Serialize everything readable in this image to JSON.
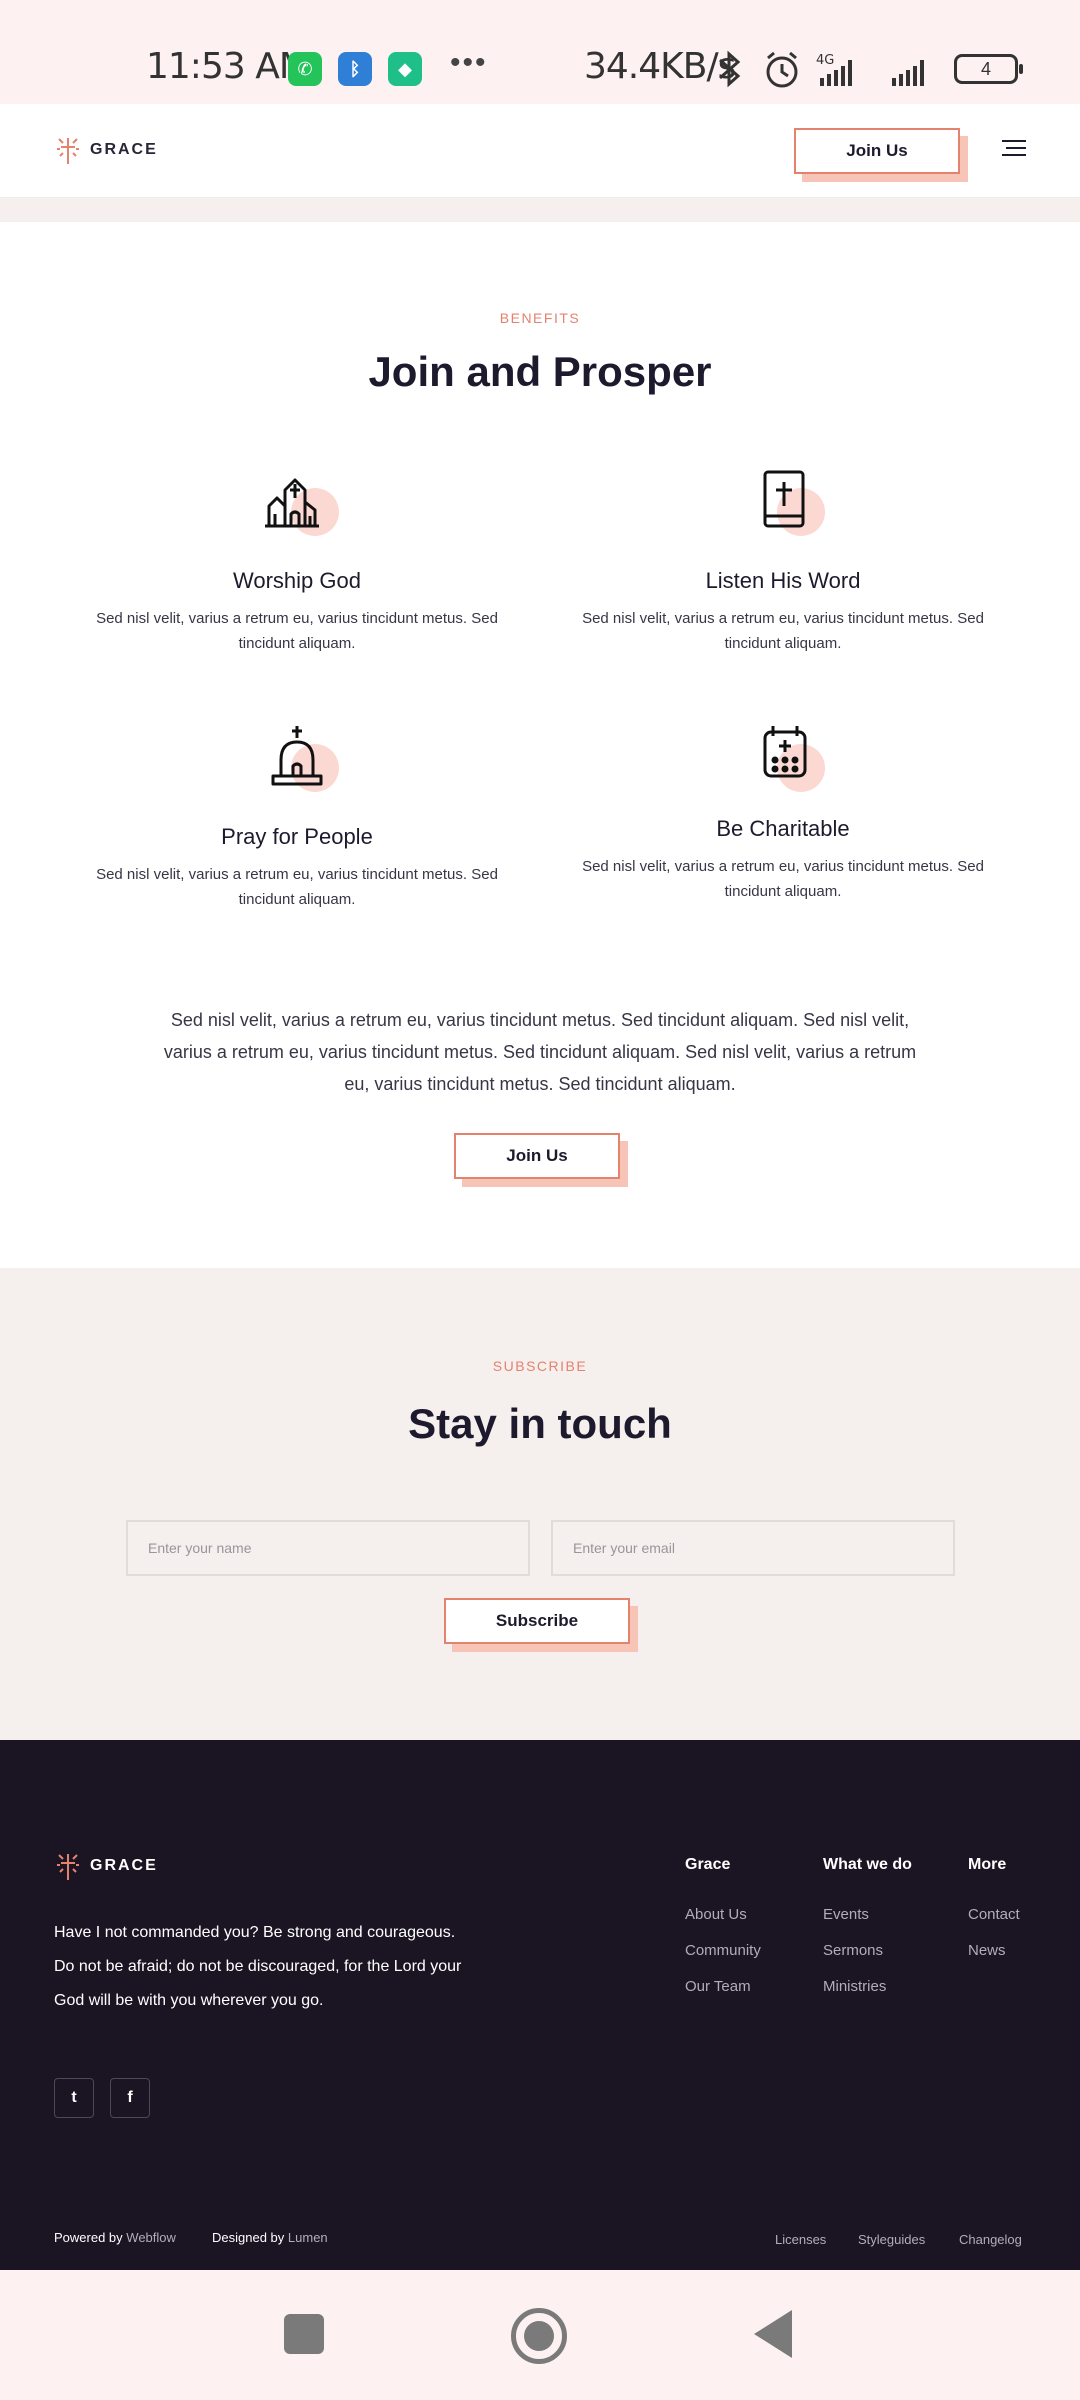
{
  "status_bar": {
    "time": "11:53 AM",
    "network_speed": "34.4KB/s",
    "network_type": "4G",
    "battery": "4",
    "app_icons": [
      "whatsapp-icon",
      "bluetooth-app-icon",
      "shield-app-icon"
    ]
  },
  "header": {
    "logo_text": "GRACE",
    "join_label": "Join Us"
  },
  "benefits": {
    "eyebrow": "BENEFITS",
    "title": "Join and Prosper",
    "features": [
      {
        "title": "Worship God",
        "text": "Sed nisl velit, varius a retrum eu, varius tincidunt metus. Sed tincidunt aliquam.",
        "icon": "church-icon"
      },
      {
        "title": "Listen His Word",
        "text": "Sed nisl velit, varius a retrum eu, varius tincidunt metus. Sed tincidunt aliquam.",
        "icon": "bible-icon"
      },
      {
        "title": "Pray for People",
        "text": "Sed nisl velit, varius a retrum eu, varius tincidunt metus. Sed tincidunt aliquam.",
        "icon": "chapel-icon"
      },
      {
        "title": "Be Charitable",
        "text": "Sed nisl velit, varius a retrum eu, varius tincidunt metus. Sed tincidunt aliquam.",
        "icon": "calendar-icon"
      }
    ],
    "paragraph": "Sed nisl velit, varius a retrum eu, varius tincidunt metus. Sed tincidunt aliquam. Sed nisl velit, varius a retrum eu, varius tincidunt metus. Sed tincidunt aliquam. Sed nisl velit, varius a retrum eu, varius tincidunt metus. Sed tincidunt aliquam.",
    "join_label": "Join Us"
  },
  "subscribe": {
    "eyebrow": "SUBSCRIBE",
    "title": "Stay in touch",
    "name_placeholder": "Enter your name",
    "email_placeholder": "Enter your email",
    "button_label": "Subscribe"
  },
  "footer": {
    "logo_text": "GRACE",
    "quote": "Have I not commanded you? Be strong and courageous. Do not be afraid; do not be discouraged, for the Lord your God will be with you wherever you go.",
    "social": [
      "twitter-icon",
      "facebook-icon"
    ],
    "columns": [
      {
        "title": "Grace",
        "links": [
          "About Us",
          "Community",
          "Our Team"
        ]
      },
      {
        "title": "What we do",
        "links": [
          "Events",
          "Sermons",
          "Ministries"
        ]
      },
      {
        "title": "More",
        "links": [
          "Contact",
          "News"
        ]
      }
    ],
    "powered_label": "Powered by",
    "powered_by": "Webflow",
    "designed_label": "Designed by",
    "designed_by": "Lumen",
    "legal": [
      "Licenses",
      "Styleguides",
      "Changelog"
    ]
  },
  "colors": {
    "accent": "#e5826e",
    "accent_light": "#f7c4b8",
    "footer_bg": "#1a1423",
    "section_bg": "#f5f0ed",
    "text_dark": "#1e1a2e"
  }
}
